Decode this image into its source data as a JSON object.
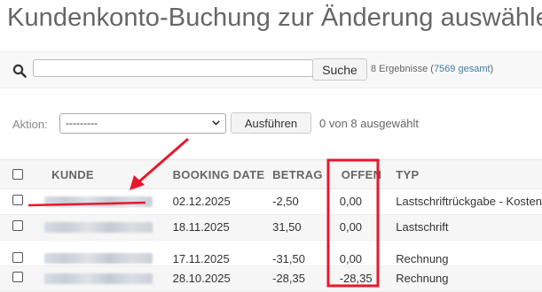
{
  "page": {
    "title": "Kundenkonto-Buchung zur Änderung auswählen"
  },
  "search": {
    "value": "",
    "button_label": "Suche",
    "result_prefix": "8 Ergebnisse (",
    "result_link": "7569 gesamt",
    "result_suffix": ")",
    "icon": "search-icon"
  },
  "actions": {
    "label": "Aktion:",
    "selected_option": "---------",
    "run_label": "Ausführen",
    "selected_count": "0 von 8 ausgewählt"
  },
  "table": {
    "headers": [
      "KUNDE",
      "BOOKING DATE",
      "BETRAG",
      "OFFEN",
      "TYP"
    ],
    "rows": [
      {
        "kunde": "",
        "date": "02.12.2025",
        "betrag": "-2,50",
        "offen": "0,00",
        "typ": "Lastschriftrückgabe - Kosten"
      },
      {
        "kunde": "",
        "date": "18.11.2025",
        "betrag": "31,50",
        "offen": "0,00",
        "typ": "Lastschrift"
      },
      {
        "kunde": "",
        "date": "17.11.2025",
        "betrag": "-31,50",
        "offen": "0,00",
        "typ": "Rechnung"
      },
      {
        "kunde": "",
        "date": "28.10.2025",
        "betrag": "-28,35",
        "offen": "-28,35",
        "typ": "Rechnung"
      }
    ]
  },
  "annotation": {
    "color": "#e8182c"
  },
  "colors": {
    "link": "#447e9b",
    "header_bg": "#f6f6f6"
  }
}
